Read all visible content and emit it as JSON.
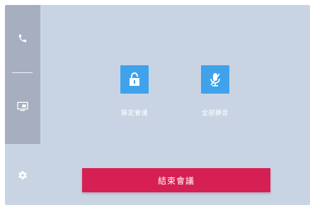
{
  "sidebar": {
    "items": [
      {
        "icon": "phone-icon"
      },
      {
        "icon": "screen-share-icon"
      }
    ],
    "settings_icon": "gear-icon"
  },
  "controls": [
    {
      "icon": "lock-open-icon",
      "label": "鎖定會議"
    },
    {
      "icon": "mic-muted-icon",
      "label": "全部靜音"
    }
  ],
  "end_button": {
    "label": "結束會議"
  },
  "colors": {
    "frame_bg": "#c8d4e4",
    "sidebar_bg": "#a7aec0",
    "tile_bg": "#3fa2ea",
    "end_button_bg": "#d61f52"
  }
}
